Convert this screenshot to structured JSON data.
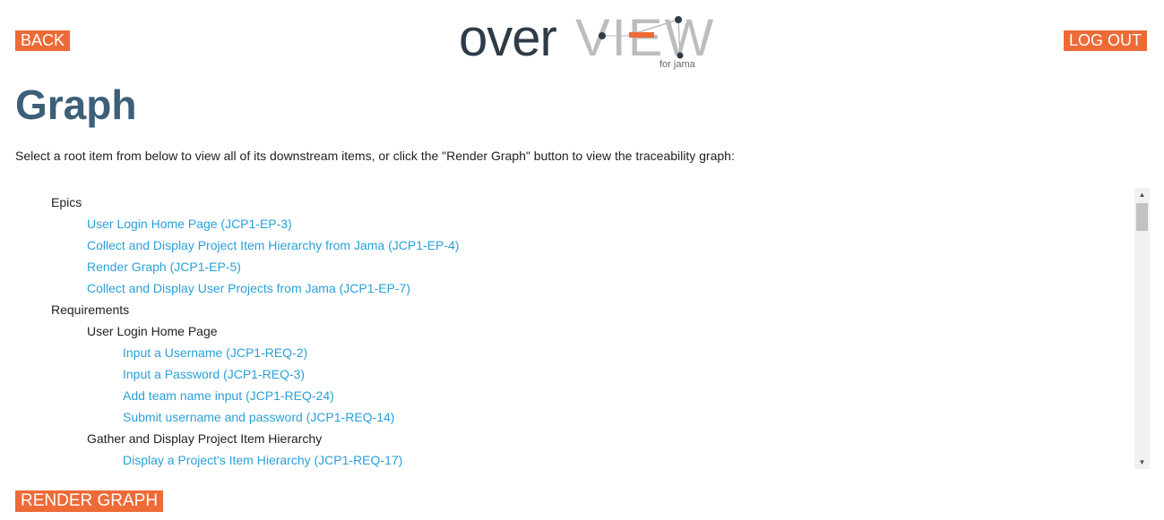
{
  "header": {
    "back_label": "BACK",
    "logout_label": "LOG OUT",
    "logo": {
      "part1": "over",
      "part2": "VIEW",
      "subtitle": "for jama",
      "colors": {
        "dark": "#2e3b48",
        "light": "#bdbdbd",
        "accent": "#ee6a37"
      }
    }
  },
  "page": {
    "title": "Graph",
    "instructions": "Select a root item from below to view all of its downstream items, or click the \"Render Graph\" button to view the traceability graph:"
  },
  "tree": {
    "items": [
      {
        "level": 0,
        "text": "Epics",
        "link": false
      },
      {
        "level": 1,
        "text": "User Login Home Page (JCP1-EP-3)",
        "link": true
      },
      {
        "level": 1,
        "text": "Collect and Display Project Item Hierarchy from Jama (JCP1-EP-4)",
        "link": true
      },
      {
        "level": 1,
        "text": "Render Graph (JCP1-EP-5)",
        "link": true
      },
      {
        "level": 1,
        "text": "Collect and Display User Projects from Jama (JCP1-EP-7)",
        "link": true
      },
      {
        "level": 0,
        "text": "Requirements",
        "link": false
      },
      {
        "level": 1,
        "text": "User Login Home Page",
        "link": false
      },
      {
        "level": 2,
        "text": "Input a Username (JCP1-REQ-2)",
        "link": true
      },
      {
        "level": 2,
        "text": "Input a Password (JCP1-REQ-3)",
        "link": true
      },
      {
        "level": 2,
        "text": "Add team name input (JCP1-REQ-24)",
        "link": true
      },
      {
        "level": 2,
        "text": "Submit username and password (JCP1-REQ-14)",
        "link": true
      },
      {
        "level": 1,
        "text": "Gather and Display Project Item Hierarchy",
        "link": false
      },
      {
        "level": 2,
        "text": "Display a Project's Item Hierarchy (JCP1-REQ-17)",
        "link": true
      }
    ]
  },
  "footer": {
    "render_label": "RENDER GRAPH"
  },
  "colors": {
    "button_bg": "#ee6a37",
    "title": "#3d5f78",
    "link": "#2aa0d8"
  },
  "icons": {
    "scroll_up": "arrow-up-icon",
    "scroll_down": "arrow-down-icon"
  }
}
